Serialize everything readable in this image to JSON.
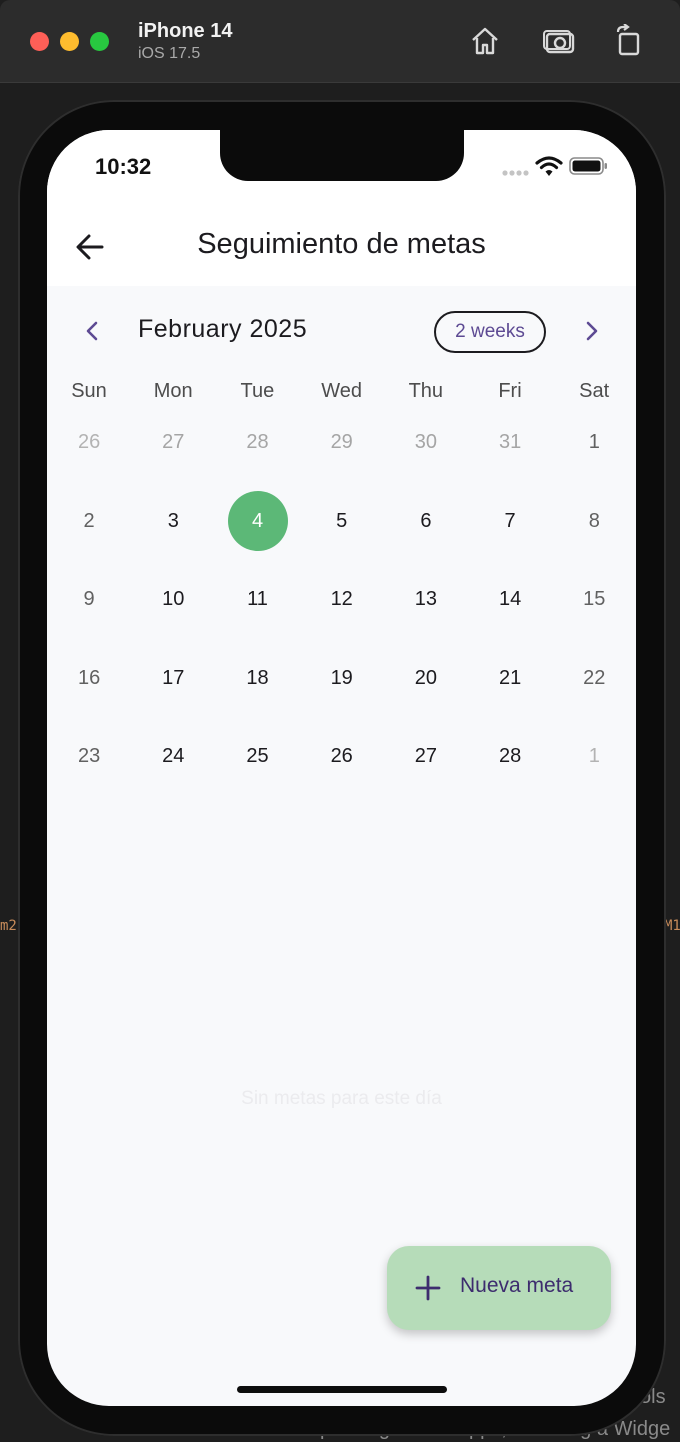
{
  "simulator": {
    "device_name": "iPhone 14",
    "os_version": "iOS 17.5",
    "icons": [
      "home-icon",
      "screenshot-icon",
      "rotate-icon"
    ]
  },
  "background": {
    "left_snippet": "m2",
    "right_snippet": "M1",
    "right_bottom_snippet": "ols",
    "bottom_snippet": "profiling Flutter apps, including a Widge"
  },
  "status_bar": {
    "time": "10:32"
  },
  "app_bar": {
    "title": "Seguimiento de metas",
    "back_icon": "arrow-left-icon"
  },
  "calendar": {
    "month_label": "February 2025",
    "format_button": "2 weeks",
    "weekdays": [
      "Sun",
      "Mon",
      "Tue",
      "Wed",
      "Thu",
      "Fri",
      "Sat"
    ],
    "weeks": [
      [
        "26",
        "27",
        "28",
        "29",
        "30",
        "31",
        "1"
      ],
      [
        "2",
        "3",
        "4",
        "5",
        "6",
        "7",
        "8"
      ],
      [
        "9",
        "10",
        "11",
        "12",
        "13",
        "14",
        "15"
      ],
      [
        "16",
        "17",
        "18",
        "19",
        "20",
        "21",
        "22"
      ],
      [
        "23",
        "24",
        "25",
        "26",
        "27",
        "28",
        "1"
      ]
    ],
    "today": "4",
    "colors": {
      "today": "#5cb877",
      "accent": "#5d4a93"
    }
  },
  "empty_message": "Sin metas para este día",
  "fab": {
    "label": "Nueva meta",
    "icon": "plus-icon",
    "color": "#b6dcb9"
  }
}
